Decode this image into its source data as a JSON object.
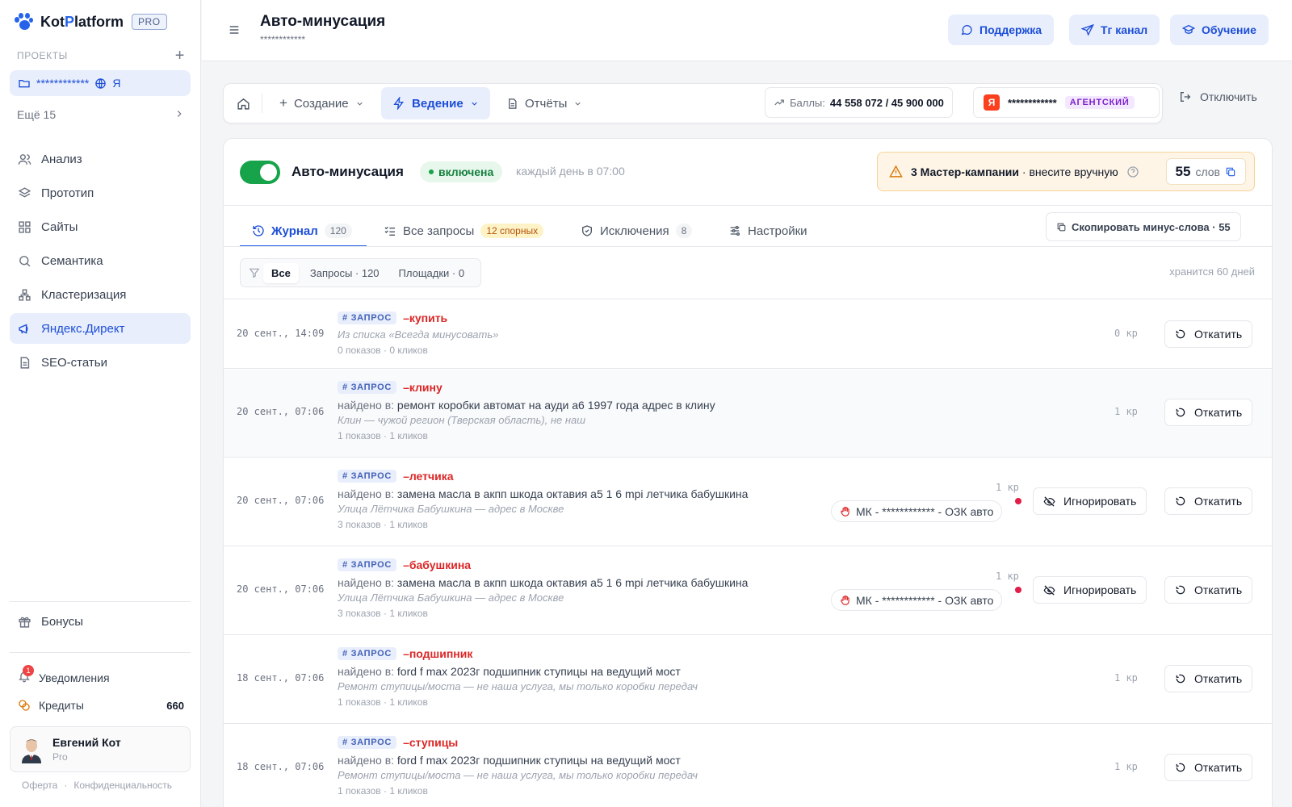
{
  "sidebar": {
    "logo": {
      "part1": "Kot",
      "part2": "P",
      "part3": "latform",
      "badge": "PRO"
    },
    "projects_header": "ПРОЕКТЫ",
    "add_symbol": "+",
    "project": {
      "name": "************",
      "suffix": "Я"
    },
    "more": "Ещё 15",
    "nav": [
      {
        "label": "Анализ",
        "icon": "users-icon"
      },
      {
        "label": "Прототип",
        "icon": "layers-icon"
      },
      {
        "label": "Сайты",
        "icon": "grid-icon"
      },
      {
        "label": "Семантика",
        "icon": "search-icon"
      },
      {
        "label": "Кластеризация",
        "icon": "cluster-icon"
      },
      {
        "label": "Яндекс.Директ",
        "icon": "megaphone-icon",
        "active": true
      },
      {
        "label": "SEO-статьи",
        "icon": "document-icon"
      }
    ],
    "bonuses": "Бонусы",
    "notifications": {
      "label": "Уведомления",
      "count": "1"
    },
    "credits": {
      "label": "Кредиты",
      "value": "660"
    },
    "user": {
      "name": "Евгений Кот",
      "plan": "Pro"
    },
    "footer": {
      "offer": "Оферта",
      "sep": "·",
      "privacy": "Конфиденциальность"
    }
  },
  "header": {
    "title": "Авто-минусация",
    "subtitle": "************",
    "buttons": {
      "support": "Поддержка",
      "tg": "Tг канал",
      "learning": "Обучение"
    }
  },
  "toolbar": {
    "create": "Создание",
    "manage": "Ведение",
    "reports": "Отчёты",
    "balls_label": "Баллы:",
    "balls_value": "44 558 072 / 45 900 000",
    "account_logo": "Я",
    "account": "************",
    "agency": "АГЕНТСКИЙ",
    "disconnect": "Отключить"
  },
  "feature": {
    "title": "Авто-минусация",
    "status": "включена",
    "schedule": "каждый день в 07:00",
    "warning_bold": "3 Мастер-кампании",
    "warning_rest": "· внесите вручную",
    "words_count": "55",
    "words_label": "слов"
  },
  "tabs": [
    {
      "label": "Журнал",
      "count": "120"
    },
    {
      "label": "Все запросы",
      "count": "12 спорных"
    },
    {
      "label": "Исключения",
      "count": "8"
    },
    {
      "label": "Настройки"
    }
  ],
  "copy_button": "Скопировать минус-слова · 55",
  "filters": {
    "all": "Все",
    "queries": "Запросы · 120",
    "sites": "Площадки · 0"
  },
  "retention": "хранится 60 дней",
  "log": {
    "tag": "# ЗАПРОС",
    "found_label": "найдено в:",
    "rollback": "Откатить",
    "ignore": "Игнорировать",
    "rows": [
      {
        "time": "20 сент., 14:09",
        "word": "–купить",
        "found": "",
        "reason": "Из списка «Всегда минусовать»",
        "stats": "0 показов · 0 кликов",
        "cost": "0 кр"
      },
      {
        "time": "20 сент., 07:06",
        "word": "–клину",
        "found": "ремонт коробки автомат на ауди а6 1997 года адрес в клину",
        "reason": "Клин — чужой регион (Тверская область), не наш",
        "stats": "1 показов · 1 кликов",
        "cost": "1 кр"
      },
      {
        "time": "20 сент., 07:06",
        "word": "–летчика",
        "found": "замена масла в акпп шкода октавия а5 1 6 mpi летчика бабушкина",
        "reason": "Улица Лётчика Бабушкина — адрес в Москве",
        "stats": "3 показов · 1 кликов",
        "cost": "1 кр",
        "campaign": "МК - ************ - ОЗК авто"
      },
      {
        "time": "20 сент., 07:06",
        "word": "–бабушкина",
        "found": "замена масла в акпп шкода октавия а5 1 6 mpi летчика бабушкина",
        "reason": "Улица Лётчика Бабушкина — адрес в Москве",
        "stats": "3 показов · 1 кликов",
        "cost": "1 кр",
        "campaign": "МК - ************ - ОЗК авто"
      },
      {
        "time": "18 сент., 07:06",
        "word": "–подшипник",
        "found": "ford f max 2023г подшипник ступицы на ведущий мост",
        "reason": "Ремонт ступицы/моста — не наша услуга, мы только коробки передач",
        "stats": "1 показов · 1 кликов",
        "cost": "1 кр"
      },
      {
        "time": "18 сент., 07:06",
        "word": "–ступицы",
        "found": "ford f max 2023г подшипник ступицы на ведущий мост",
        "reason": "Ремонт ступицы/моста — не наша услуга, мы только коробки передач",
        "stats": "1 показов · 1 кликов",
        "cost": "1 кр"
      }
    ]
  },
  "colors": {
    "accent": "#2563eb",
    "success": "#16a34a",
    "danger": "#dc2626",
    "warning_bg": "#fef5e7"
  }
}
